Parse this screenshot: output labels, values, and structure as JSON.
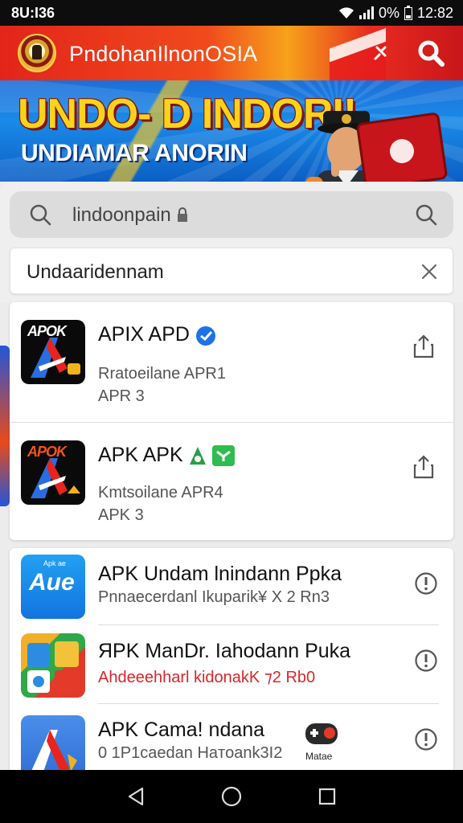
{
  "status_bar": {
    "time_left": "8U:I36",
    "battery": "0%",
    "time_right": "12:82"
  },
  "header": {
    "title": "PndohanIlnonOSIA",
    "logo_icon": "emblem-logo",
    "pin_icon": "pin-icon",
    "search_icon": "search-icon"
  },
  "banner": {
    "headline": "UNDO- D INDORI!",
    "subtitle": "UNDIAMAR ANORIN"
  },
  "search": {
    "value": "lindoonpain",
    "placeholder": "lindoonpain"
  },
  "filter": {
    "value": "Undaaridennam"
  },
  "apps_top": [
    {
      "icon_text": "APOK",
      "title": "APIX APD",
      "line1": "Rratoeilane APR1",
      "line2": "APR 3"
    },
    {
      "icon_text": "APOK",
      "title": "APK APK",
      "line1": "Kmtsoilane APR4",
      "line2": "APK 3"
    }
  ],
  "apps_bottom": [
    {
      "icon_text": "Aue",
      "icon_small": "Apk ae",
      "title": "APK Undam lnindann Ppka",
      "subtitle": "Pnnaecerdanl Ikuparik¥ X 2 Rn3",
      "subtitle_red": false
    },
    {
      "title": "ЯPK ManDr. Iahodann Puka",
      "subtitle": "Ahdeeehharl kidonakK  ⁊2 Rb0",
      "subtitle_red": true
    },
    {
      "title": "APK Cama!     ndana",
      "subtitle": "0 1P1caedan Haтoank3I2",
      "extra_label": "Matae"
    }
  ],
  "colors": {
    "header_red": "#e3241a",
    "accent_blue": "#1a8ae8",
    "accent_yellow": "#ffd21a"
  }
}
